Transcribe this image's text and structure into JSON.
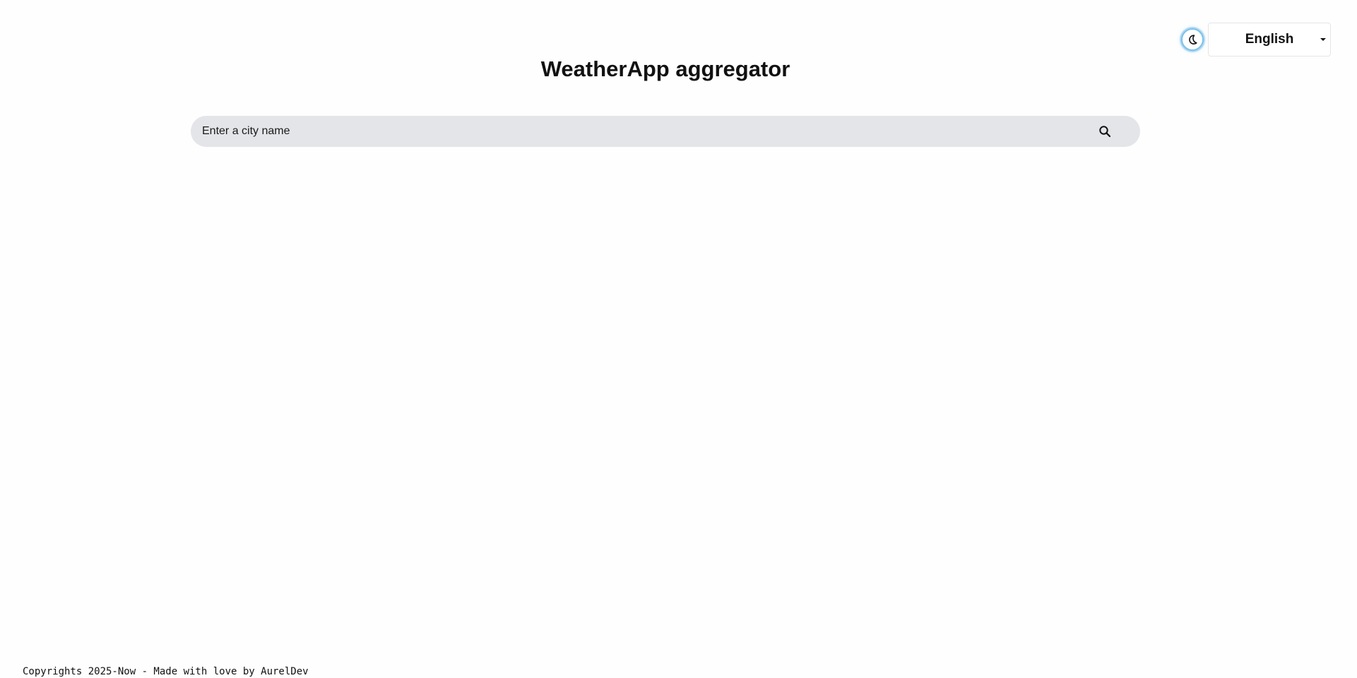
{
  "header": {
    "theme_toggle_icon": "moon-icon",
    "language": {
      "selected": "English"
    }
  },
  "main": {
    "title": "WeatherApp aggregator",
    "search": {
      "placeholder": "Enter a city name",
      "value": "",
      "icon": "search-icon"
    }
  },
  "footer": {
    "text": "Copyrights 2025-Now - Made with love by AurelDev"
  },
  "colors": {
    "page_background": "#fefefe",
    "search_background": "#e4e5e8",
    "toggle_ring": "#7cc2ea"
  }
}
